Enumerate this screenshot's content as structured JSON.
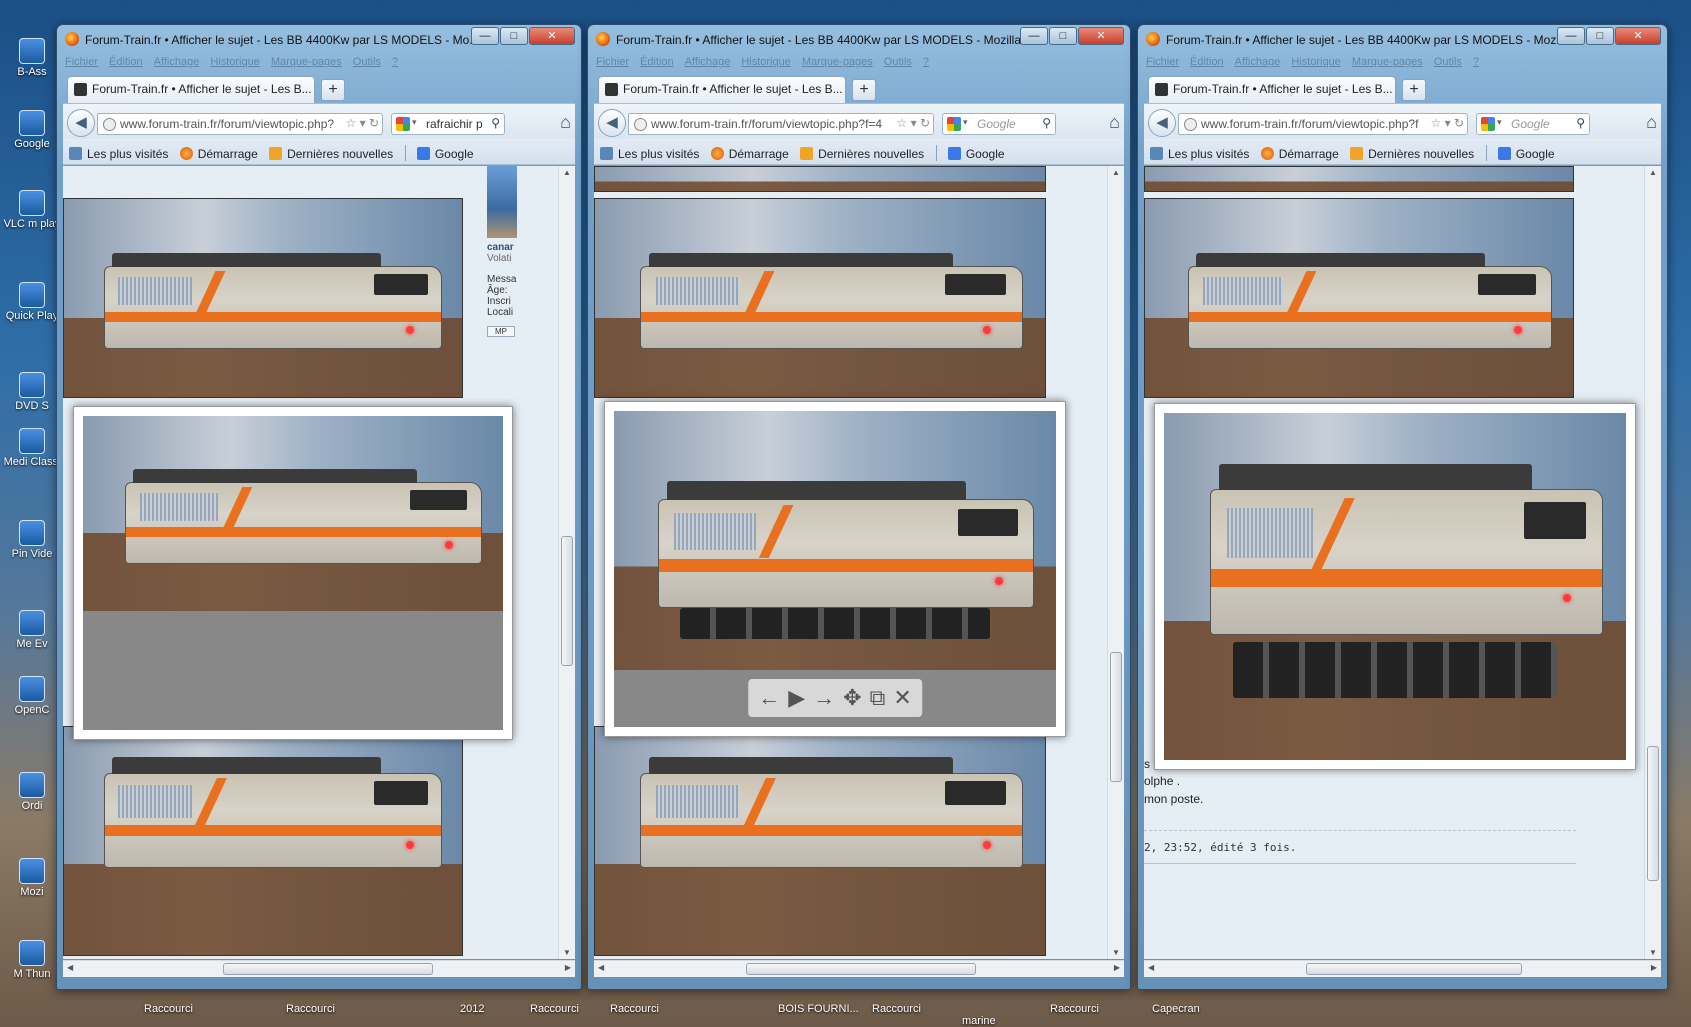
{
  "desktop": {
    "icons": [
      "B-Ass",
      "Google",
      "VLC m play",
      "Quick Play",
      "DVD S",
      "Medi Classi",
      "Pin Vide",
      "Me Ev",
      "OpenC",
      "Ordi",
      "Mozi",
      "M Thun"
    ],
    "taskbar_labels": [
      "Raccourci",
      "Raccourci",
      "2012",
      "Raccourci",
      "Raccourci",
      "BOIS FOURNI...",
      "Raccourci",
      "marine",
      "Raccourci",
      "Capecran"
    ]
  },
  "windows": [
    {
      "title": "Forum-Train.fr • Afficher le sujet - Les BB 4400Kw par LS MODELS - Mo...",
      "menu": [
        "Fichier",
        "Édition",
        "Affichage",
        "Historique",
        "Marque-pages",
        "Outils",
        "?"
      ],
      "tab_label": "Forum-Train.fr • Afficher le sujet - Les B...",
      "url": "www.forum-train.fr/forum/viewtopic.php?",
      "search_value": "rafraichir p",
      "search_is_placeholder": false
    },
    {
      "title": "Forum-Train.fr • Afficher le sujet - Les BB 4400Kw par LS MODELS - Mozilla...",
      "menu": [
        "Fichier",
        "Édition",
        "Affichage",
        "Historique",
        "Marque-pages",
        "Outils",
        "?"
      ],
      "tab_label": "Forum-Train.fr • Afficher le sujet - Les B...",
      "url": "www.forum-train.fr/forum/viewtopic.php?f=4",
      "search_value": "Google",
      "search_is_placeholder": true
    },
    {
      "title": "Forum-Train.fr • Afficher le sujet - Les BB 4400Kw par LS MODELS - Mozi...",
      "menu": [
        "Fichier",
        "Édition",
        "Affichage",
        "Historique",
        "Marque-pages",
        "Outils",
        "?"
      ],
      "tab_label": "Forum-Train.fr • Afficher le sujet - Les B...",
      "url": "www.forum-train.fr/forum/viewtopic.php?f",
      "search_value": "Google",
      "search_is_placeholder": true
    }
  ],
  "window_controls": {
    "minimize": "—",
    "maximize": "□",
    "close": "✕"
  },
  "bookmarks": [
    "Les plus visités",
    "Démarrage",
    "Dernières nouvelles",
    "Google"
  ],
  "user_panel": {
    "username": "canar",
    "role": "Volati",
    "fields": [
      "Messa",
      "Âge:",
      "Inscri",
      "Locali"
    ],
    "mp_label": "MP"
  },
  "lightbox_tools": [
    "←",
    "▶",
    "→",
    "✥",
    "⧉",
    "✕"
  ],
  "post": {
    "line1": "s",
    "line2": "olphe .",
    "line3": "mon poste.",
    "edited": "2, 23:52, édité 3 fois."
  },
  "toolbar_icons": {
    "back": "arrow-left",
    "home": "house",
    "search": "magnifier",
    "reload": "reload",
    "bookmark_star": "star"
  }
}
